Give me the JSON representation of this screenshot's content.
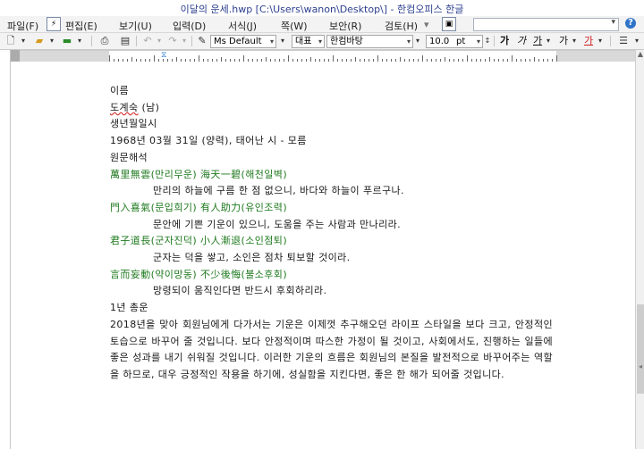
{
  "window": {
    "title": "이달의 운세.hwp [C:\\Users\\wanon\\Desktop\\] - 한컴오피스 한글"
  },
  "menubar": {
    "items": [
      "파일(F)",
      "편집(E)",
      "보기(U)",
      "입력(D)",
      "서식(J)",
      "쪽(W)",
      "보안(R)",
      "검토(H)"
    ],
    "combo_value": ""
  },
  "toolbar": {
    "style_value": "Ms Default",
    "lang_value": "대표",
    "font_value": "한컴바탕",
    "size_value": "10.0",
    "size_unit": "pt",
    "format_glyphs": [
      "가",
      "가",
      "가",
      "가",
      "가"
    ]
  },
  "document": {
    "lines": [
      {
        "text": "이름",
        "style": ""
      },
      {
        "text": "도계숙(남)",
        "style": ""
      },
      {
        "text": "",
        "style": ""
      },
      {
        "text": "생년월일시",
        "style": ""
      },
      {
        "text": "1968년 03월 31일 (양력), 태어난 시 - 모름",
        "style": ""
      },
      {
        "text": "",
        "style": ""
      },
      {
        "text": "원문해석",
        "style": ""
      },
      {
        "text": "萬里無雲(만리무운) 海天一碧(해천일벽)",
        "style": "green"
      },
      {
        "text": "만리의 하늘에 구름 한 점 없으니, 바다와 하늘이 푸르구나.",
        "style": "indent"
      },
      {
        "text": "門入喜氣(문입희기) 有人助力(유인조력)",
        "style": "green"
      },
      {
        "text": "문안에 기쁜 기운이 있으니, 도움을 주는 사람과 만나리라.",
        "style": "indent"
      },
      {
        "text": "君子道長(군자진덕) 小人漸退(소인점퇴)",
        "style": "green"
      },
      {
        "text": "군자는 덕을 쌓고, 소인은 점차 퇴보할 것이라.",
        "style": "indent"
      },
      {
        "text": "言而妄動(약이망동) 不少後悔(불소후회)",
        "style": "green"
      },
      {
        "text": "망령되이 움직인다면 반드시 후회하리라.",
        "style": "indent"
      },
      {
        "text": "",
        "style": ""
      },
      {
        "text": "1년 총운",
        "style": ""
      }
    ],
    "paragraph": "2018년을 맞아 회원님에게 다가서는 기운은 이제껏 추구해오던 라이프 스타일을 보다 크고, 안정적인 토습으로 바꾸어 줄 것입니다. 보다 안정적이며 따스한 가정이 될 것이고, 사회에서도, 진행하는 일들에 좋은 성과를 내기 쉬워질 것입니다. 이러한 기운의 흐름은 회원님의 본질을 발전적으로 바꾸어주는 역할을 하므로, 대우 긍정적인 작용을 하기에, 성실함을 지킨다면, 좋은 한 해가 되어줄 것입니다."
  }
}
